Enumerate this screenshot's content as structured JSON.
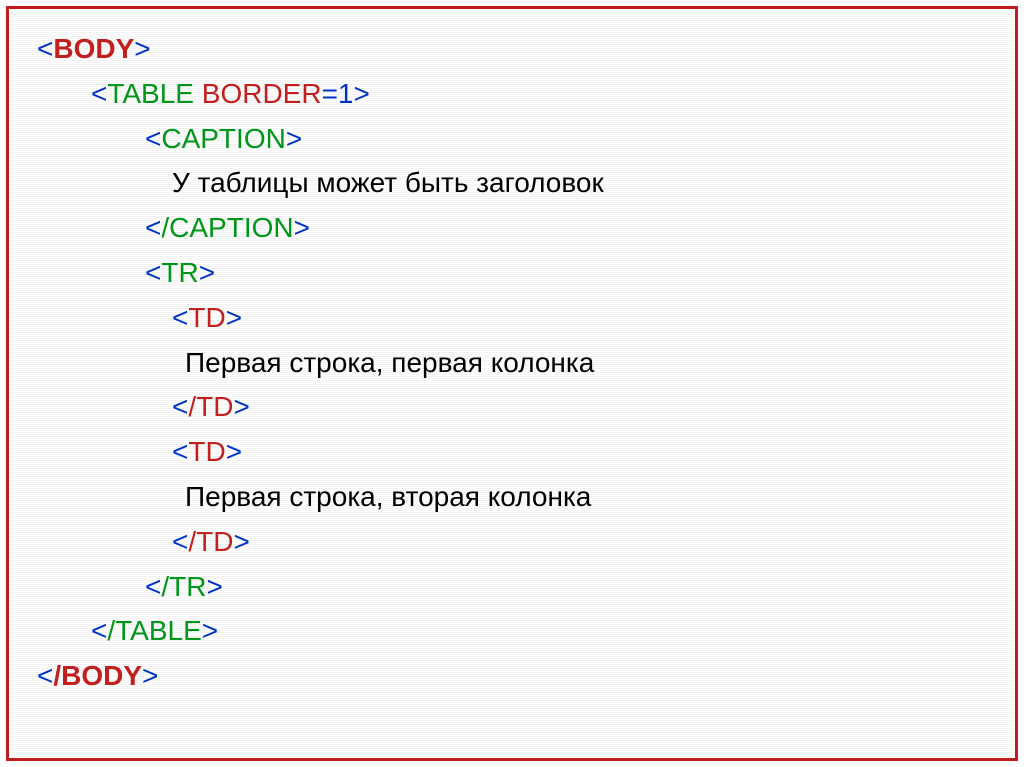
{
  "code": {
    "tag_body_open": "BODY",
    "tag_body_close": "BODY",
    "tag_table": "TABLE",
    "attr_border": "BORDER",
    "attr_border_value": "1",
    "tag_table_close": "TABLE",
    "tag_caption_open": "CAPTION",
    "tag_caption_close": "CAPTION",
    "caption_text": "У таблицы может быть заголовок",
    "tag_tr_open": "TR",
    "tag_tr_close": "TR",
    "tag_td_open": "TD",
    "tag_td_close": "TD",
    "td1_text": "Первая строка, первая колонка",
    "td2_text": "Первая строка, вторая колонка",
    "lt": "<",
    "gt": ">",
    "slash": "/",
    "equals": "="
  }
}
